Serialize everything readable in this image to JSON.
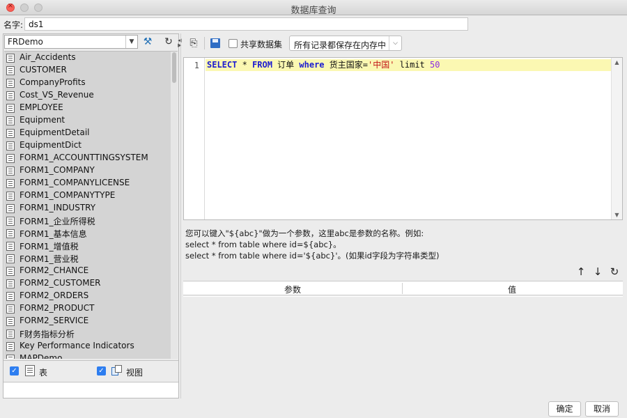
{
  "window": {
    "title": "数据库查询"
  },
  "name_field": {
    "label": "名字:",
    "value": "ds1"
  },
  "left": {
    "connection": "FRDemo",
    "tables": [
      "Air_Accidents",
      "CUSTOMER",
      "CompanyProfits",
      "Cost_VS_Revenue",
      "EMPLOYEE",
      "Equipment",
      "EquipmentDetail",
      "EquipmentDict",
      "FORM1_ACCOUNTTINGSYSTEM",
      "FORM1_COMPANY",
      "FORM1_COMPANYLICENSE",
      "FORM1_COMPANYTYPE",
      "FORM1_INDUSTRY",
      "FORM1_企业所得税",
      "FORM1_基本信息",
      "FORM1_增值税",
      "FORM1_营业税",
      "FORM2_CHANCE",
      "FORM2_CUSTOMER",
      "FORM2_ORDERS",
      "FORM2_PRODUCT",
      "FORM2_SERVICE",
      "F财务指标分析",
      "Key Performance Indicators",
      "MAPDemo"
    ],
    "filter_table_label": "表",
    "filter_view_label": "视图",
    "filter_table_checked": true,
    "filter_view_checked": true
  },
  "toolbar": {
    "share_label": "共享数据集",
    "share_checked": false,
    "memory_option": "所有记录都保存在内存中"
  },
  "editor": {
    "line_number": "1",
    "sql_tokens": [
      {
        "t": "SELECT",
        "c": "kw"
      },
      {
        "t": " * ",
        "c": "tx"
      },
      {
        "t": "FROM",
        "c": "kw"
      },
      {
        "t": " 订单 ",
        "c": "tx"
      },
      {
        "t": "where",
        "c": "kw"
      },
      {
        "t": " 货主国家=",
        "c": "tx"
      },
      {
        "t": "'中国'",
        "c": "str"
      },
      {
        "t": " limit ",
        "c": "fn"
      },
      {
        "t": "50",
        "c": "num"
      }
    ]
  },
  "hint": {
    "line1": "您可以键入\"${abc}\"做为一个参数，这里abc是参数的名称。例如:",
    "line2": "select * from table where id=${abc}。",
    "line3": "select * from table where id='${abc}'。(如果id字段为字符串类型)"
  },
  "params": {
    "col_name": "参数",
    "col_value": "值"
  },
  "buttons": {
    "ok": "确定",
    "cancel": "取消"
  },
  "icons": {
    "preview": "preview-icon",
    "save": "save-disk-icon",
    "wrench": "wrench-icon",
    "refresh": "refresh-icon",
    "up": "arrow-up-icon",
    "down": "arrow-down-icon"
  },
  "colors": {
    "keyword": "#1b1bd0",
    "string": "#c21515",
    "number": "#8a2be2",
    "highlight": "#fbf8b2",
    "checkbox": "#2e7ef0"
  }
}
